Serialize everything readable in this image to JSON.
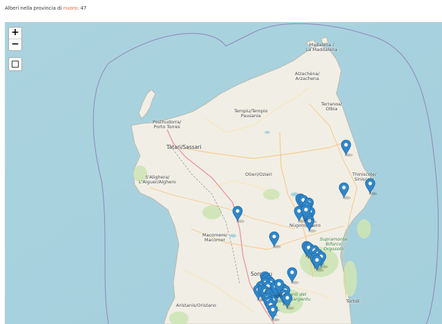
{
  "header": {
    "prefix": "Alberi nella provincia di ",
    "province": "nuoro",
    "suffix": ": 47"
  },
  "controls": {
    "zoom_in": "+",
    "zoom_out": "−"
  },
  "places": {
    "maddalena": "Madalena /\nLa Maddalena",
    "arzachena": "Alzachèna/\nArzachena",
    "tempio": "Tempiu/Tempio\nPausania",
    "olbia": "Terranoa/\nOlbia",
    "porto_torres": "Posthudorra/\nPorto Torres",
    "sassari": "Tàtari/Sassari",
    "alghero": "S'Alighera/\nL'Alguer/Alghero",
    "ozieri": "Otieri/Ozieri",
    "siniscola": "Thiniscole/\nSiniscola",
    "nuoro": "Nùgoro/Nuoro",
    "macomer": "Macomere/\nMacomer",
    "sorgono": "Sorgonu",
    "oristano": "Aristanis/Oristano",
    "tortoli": "Tortolì",
    "gennargentu": "Monti del\nGennargentu",
    "supramonte": "Supramonte\nBiforco\nOrgosolo"
  },
  "marker_count": 47
}
